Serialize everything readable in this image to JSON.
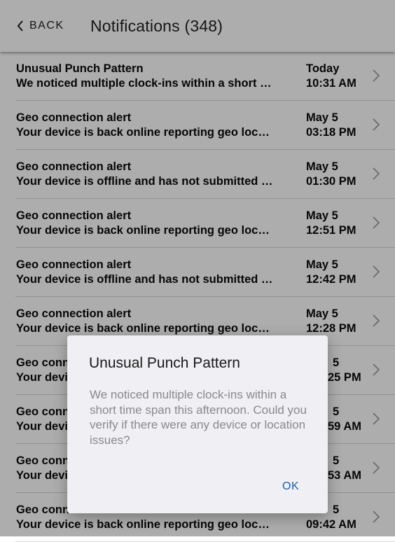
{
  "header": {
    "back_label": "BACK",
    "title": "Notifications (348)"
  },
  "notifications": [
    {
      "title": "Unusual Punch Pattern",
      "message": "We noticed multiple clock-ins within a short …",
      "date": "Today",
      "time": "10:31 AM"
    },
    {
      "title": "Geo connection alert",
      "message": "Your device is back online reporting geo loc…",
      "date": "May 5",
      "time": "03:18 PM"
    },
    {
      "title": "Geo connection alert",
      "message": "Your device is offline and has not submitted …",
      "date": "May 5",
      "time": "01:30 PM"
    },
    {
      "title": "Geo connection alert",
      "message": "Your device is back online reporting geo loc…",
      "date": "May 5",
      "time": "12:51 PM"
    },
    {
      "title": "Geo connection alert",
      "message": "Your device is offline and has not submitted …",
      "date": "May 5",
      "time": "12:42 PM"
    },
    {
      "title": "Geo connection alert",
      "message": "Your device is back online reporting geo loc…",
      "date": "May 5",
      "time": "12:28 PM"
    },
    {
      "title": "Geo conn",
      "message": "Your devi",
      "date": "5",
      "time": "25 PM"
    },
    {
      "title": "Geo conn",
      "message": "Your devi",
      "date": "5",
      "time": "59 AM"
    },
    {
      "title": "Geo conn",
      "message": "Your devi",
      "date": "5",
      "time": "53 AM"
    },
    {
      "title": "Geo conn",
      "message": "Your device is back online reporting geo loc…",
      "date": "5",
      "time": "09:42 AM"
    }
  ],
  "dialog": {
    "title": "Unusual Punch Pattern",
    "message": "We noticed multiple clock-ins within a short time span this afternoon. Could you verify if there were any device or location issues?",
    "ok_label": "OK"
  }
}
